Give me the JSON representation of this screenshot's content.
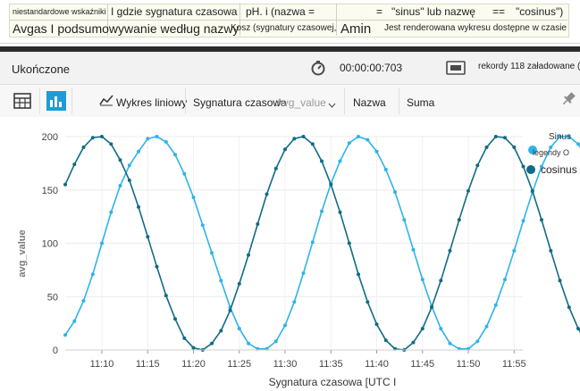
{
  "query": {
    "line1": {
      "custom_metrics": "niestandardowe wskaźniki",
      "where_timestamp": "I gdzie sygnatura czasowa",
      "ph_name_eq": "pH. i (nazwa =",
      "eq": "=",
      "sinus_or_name": "\"sinus\" lub nazwę",
      "eqeq": "==",
      "cosinus": "\"cosinus\")"
    },
    "line2": {
      "avg_summarize": "Avgas I podsumowywanie według nazwy",
      "bin": "Kosz (sygnatury czasowej,",
      "amin": "Amin",
      "render": "Jest renderowana wykresu dostępne w czasie"
    }
  },
  "status": {
    "state": "Ukończone",
    "elapsed": "00:00:00:703",
    "records": "rekordy 118 załadowane ("
  },
  "toolbar": {
    "line_chart": "Wykres liniowy",
    "timestamp": "Sygnatura czasowa",
    "avg_value": "Avg_value",
    "name": "Nazwa",
    "sum": "Suma"
  },
  "icons": {
    "stopwatch": "stopwatch-icon",
    "records": "records-icon",
    "table": "table-icon",
    "chart": "bar-chart-icon",
    "line": "line-chart-icon",
    "pin": "pin-icon"
  },
  "colors": {
    "sinus": "#2fb3e8",
    "cosinus": "#126b85",
    "active_chart_icon": "#1f9bd7"
  },
  "chart_data": {
    "type": "line",
    "xlabel": "Sygnatura czasowa [UTC I",
    "ylabel": "avg_value",
    "x_start": "11:06",
    "x_step_minutes": 1,
    "x_ticks": [
      "11:10",
      "11:15",
      "11:20",
      "11:25",
      "11:30",
      "11:35",
      "11:40",
      "11:45",
      "11:50",
      "11:55"
    ],
    "y_ticks": [
      0,
      50,
      100,
      150,
      200
    ],
    "ylim": [
      0,
      200
    ],
    "legend": {
      "title": "Sinus",
      "subtitle": "legendy O",
      "entries": [
        "",
        "cosinus"
      ]
    },
    "series": [
      {
        "name": "Sinus",
        "color": "#2fb3e8",
        "values": [
          14,
          27,
          46,
          71,
          100,
          129,
          154,
          173,
          186,
          198,
          200,
          195,
          183,
          165,
          143,
          117,
          91,
          65,
          40,
          20,
          6,
          1,
          1,
          8,
          23,
          45,
          72,
          101,
          130,
          156,
          177,
          194,
          200,
          197,
          186,
          169,
          148,
          122,
          94,
          66,
          41,
          20,
          6,
          1,
          1,
          8,
          22,
          42,
          66,
          93,
          121,
          148,
          172,
          190,
          200,
          200,
          193,
          179
        ]
      },
      {
        "name": "cosinus",
        "color": "#126b85",
        "values": [
          155,
          174,
          190,
          199,
          200,
          193,
          178,
          159,
          134,
          106,
          78,
          51,
          29,
          11,
          2,
          0,
          6,
          18,
          37,
          62,
          89,
          118,
          146,
          170,
          188,
          198,
          200,
          193,
          177,
          155,
          129,
          100,
          71,
          45,
          24,
          9,
          1,
          0,
          7,
          20,
          40,
          65,
          93,
          122,
          149,
          173,
          190,
          200,
          199,
          190,
          172,
          149,
          122,
          93,
          65,
          40,
          20,
          6
        ]
      }
    ]
  }
}
